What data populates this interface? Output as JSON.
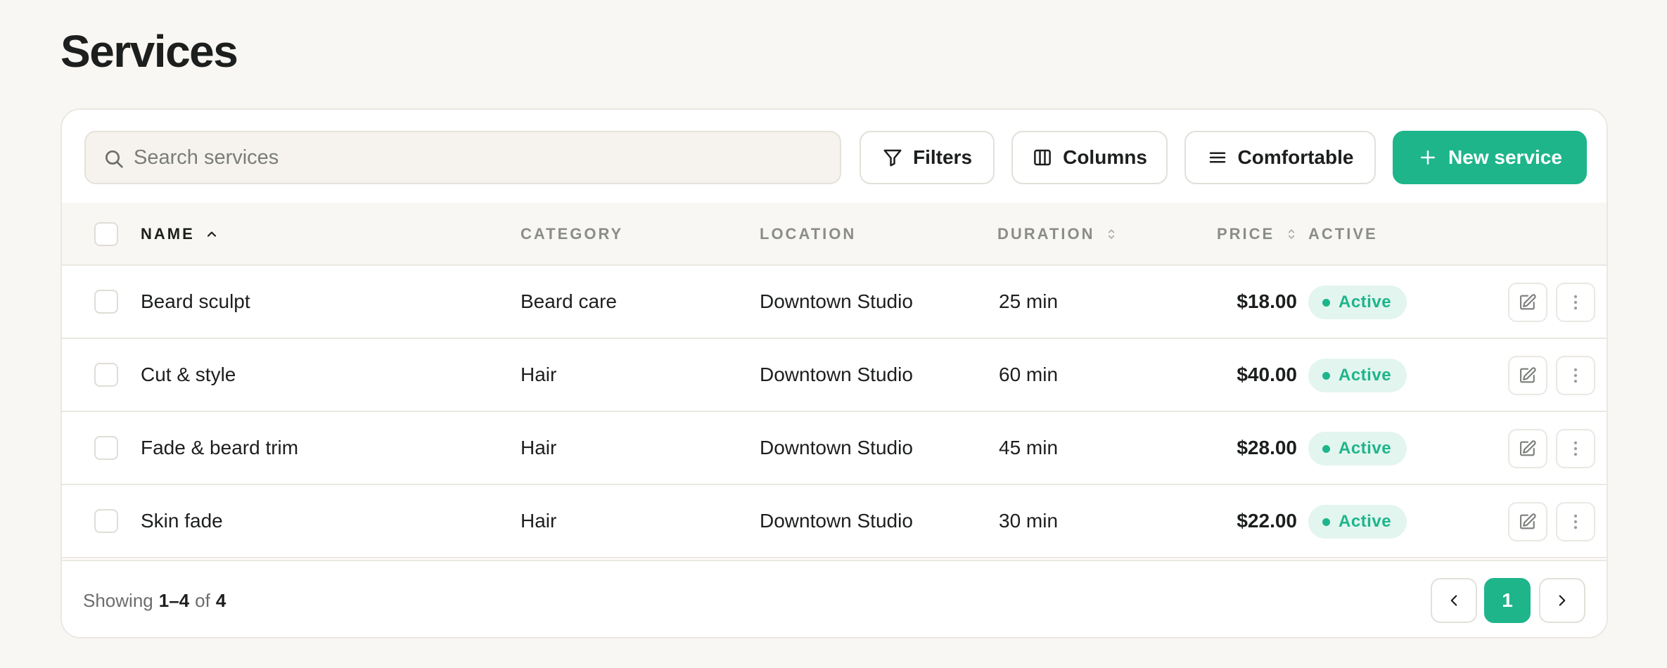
{
  "page": {
    "title": "Services"
  },
  "toolbar": {
    "search_placeholder": "Search services",
    "filters_label": "Filters",
    "columns_label": "Columns",
    "density_label": "Comfortable",
    "new_label": "New service"
  },
  "table": {
    "columns": {
      "name": "NAME",
      "category": "CATEGORY",
      "location": "LOCATION",
      "duration": "DURATION",
      "price": "PRICE",
      "active": "ACTIVE"
    },
    "sort": {
      "column": "name",
      "direction": "ascending"
    },
    "rows": [
      {
        "name": "Beard sculpt",
        "category": "Beard care",
        "location": "Downtown Studio",
        "duration": "25 min",
        "price": "$18.00",
        "status": "Active"
      },
      {
        "name": "Cut & style",
        "category": "Hair",
        "location": "Downtown Studio",
        "duration": "60 min",
        "price": "$40.00",
        "status": "Active"
      },
      {
        "name": "Fade & beard trim",
        "category": "Hair",
        "location": "Downtown Studio",
        "duration": "45 min",
        "price": "$28.00",
        "status": "Active"
      },
      {
        "name": "Skin fade",
        "category": "Hair",
        "location": "Downtown Studio",
        "duration": "30 min",
        "price": "$22.00",
        "status": "Active"
      }
    ]
  },
  "footer": {
    "showing_prefix": "Showing",
    "range": "1–4",
    "of_label": "of",
    "total": "4",
    "current_page": "1"
  },
  "colors": {
    "accent": "#1eb58b",
    "badge_bg": "#e2f5ee",
    "page_bg": "#f9f7f3"
  }
}
